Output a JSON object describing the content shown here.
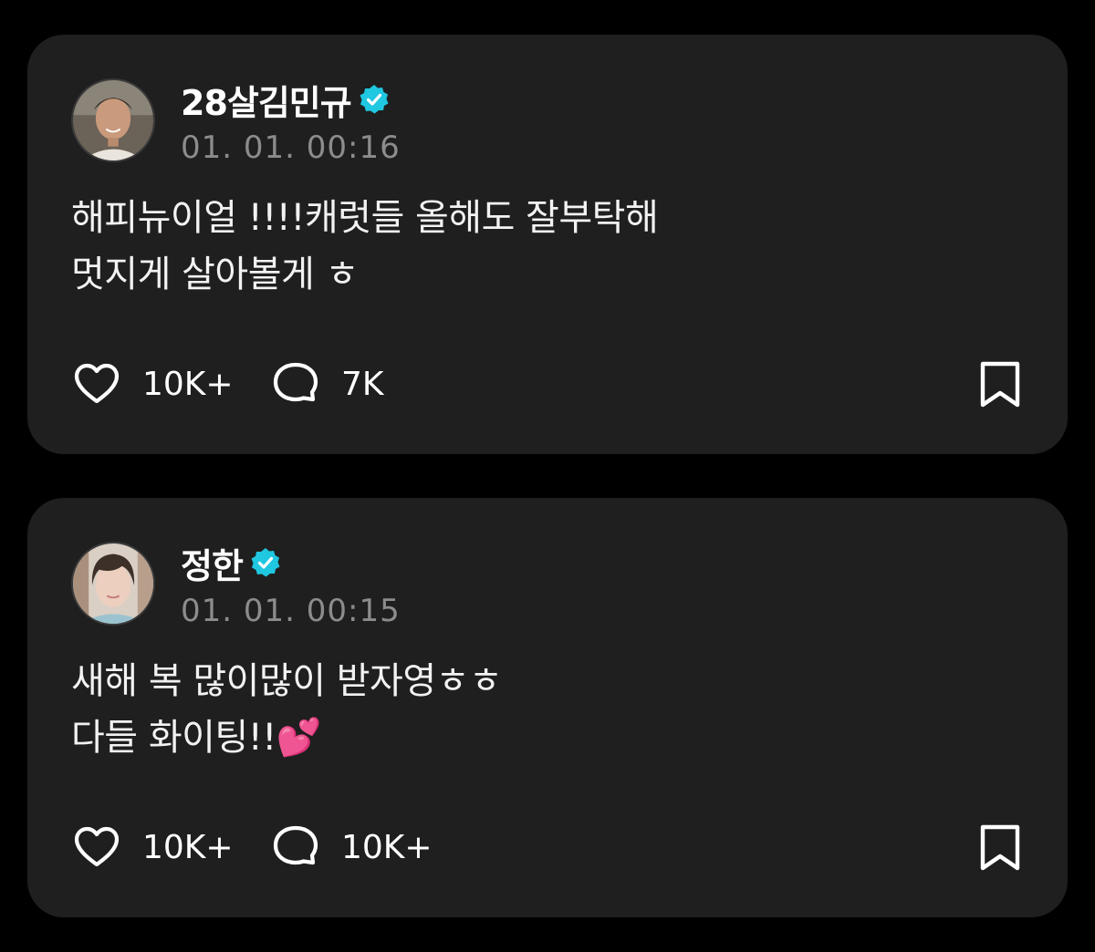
{
  "theme": {
    "background": "#000000",
    "card_background": "#1f1f1f",
    "verified_color": "#1fc7e0",
    "timestamp_color": "#8c8c8c"
  },
  "posts": [
    {
      "username": "28살김민규",
      "verified": true,
      "timestamp": "01. 01. 00:16",
      "body_lines": [
        "해피뉴이얼 !!!!캐럿들 올해도 잘부탁해",
        "멋지게 살아볼게 ㅎ"
      ],
      "likes": "10K+",
      "comments": "7K",
      "icons": [
        "heart-icon",
        "comment-bubble-icon",
        "bookmark-icon",
        "verified-badge-icon"
      ]
    },
    {
      "username": "정한",
      "verified": true,
      "timestamp": "01. 01. 00:15",
      "body_lines": [
        "새해 복 많이많이 받자영ㅎㅎ",
        "다들 화이팅!!💕"
      ],
      "likes": "10K+",
      "comments": "10K+",
      "icons": [
        "heart-icon",
        "comment-bubble-icon",
        "bookmark-icon",
        "verified-badge-icon"
      ]
    }
  ]
}
